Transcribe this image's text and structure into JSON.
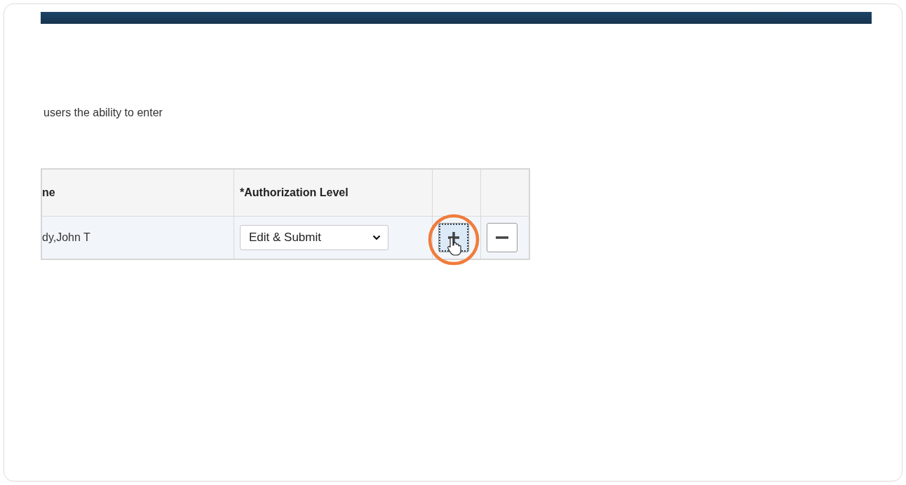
{
  "intro_text": "users the ability to enter",
  "table": {
    "columns": [
      "ne",
      "*Authorization Level",
      "",
      ""
    ],
    "rows": [
      {
        "name": "dy,John T",
        "authorization_level": "Edit & Submit",
        "buttons": [
          {
            "kind": "add",
            "focused": true,
            "highlighted": true
          },
          {
            "kind": "remove",
            "focused": false,
            "highlighted": false
          }
        ]
      }
    ]
  }
}
